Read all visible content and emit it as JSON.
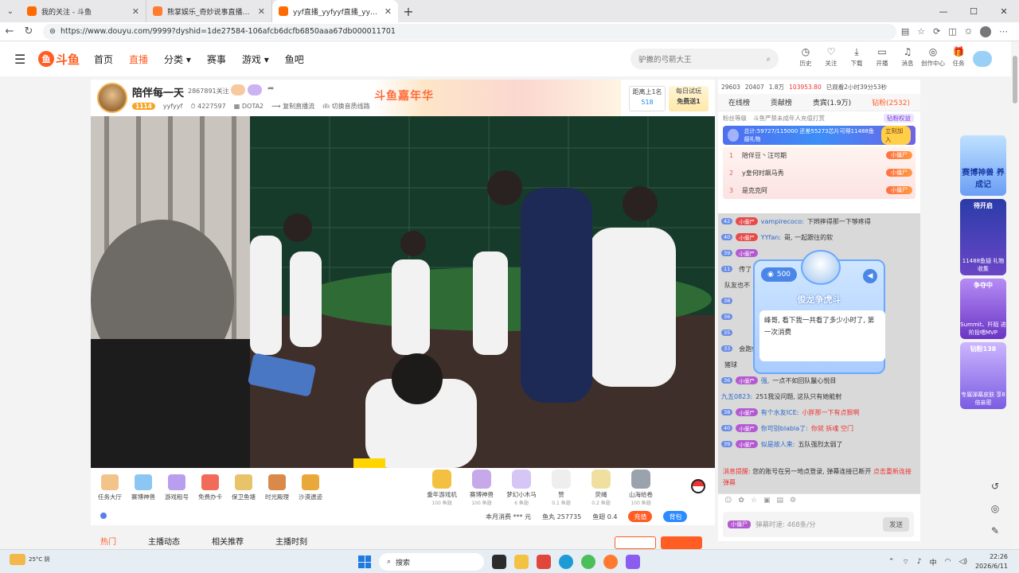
{
  "browser": {
    "tabs": [
      {
        "title": "我的关注 - 斗鱼",
        "active": false
      },
      {
        "title": "熊掌娱乐_奇妙说事直播_奇妙说事",
        "active": false
      },
      {
        "title": "yyf直播_yyfyyf直播_yyfDOTA2直播",
        "active": true
      }
    ],
    "url": "https://www.douyu.com/9999?dyshid=1de27584-106afcb6dcfb6850aaa67db000011701"
  },
  "header": {
    "logo_text": "斗鱼",
    "nav": [
      "首页",
      "直播",
      "分类",
      "赛事",
      "游戏",
      "鱼吧"
    ],
    "search_placeholder": "驴撒的弓箭大王",
    "icons": [
      "历史",
      "关注",
      "下载",
      "开播",
      "消息",
      "创作中心",
      "任务"
    ]
  },
  "room": {
    "name": "陪伴每一天",
    "followers": "2867891关注",
    "level": "1114",
    "id": "yyfyyf",
    "hot": "4227597",
    "category": "DOTA2",
    "copy_label": "复制直播流",
    "switch_label": "切换音质线路",
    "banner_text": "斗鱼嘉年华",
    "rank_label": "距离上1名",
    "rank_value": "518",
    "daily_label": "每日试玩",
    "daily_value": "免费送1"
  },
  "gift_bar": {
    "left_items": [
      "任务大厅",
      "赛博神兽",
      "游戏租号",
      "免费办卡",
      "保卫鱼塘",
      "时光殿理",
      "沙漠遗迹"
    ],
    "gifts": [
      {
        "name": "重年游戏机",
        "price": "100 鱼翅"
      },
      {
        "name": "赛博神兽",
        "price": "100 鱼翅"
      },
      {
        "name": "梦幻小木马",
        "price": "6 鱼翅"
      },
      {
        "name": "赞",
        "price": "0.1 鱼翅"
      },
      {
        "name": "荧绳",
        "price": "0.2 鱼翅"
      },
      {
        "name": "山海给卷",
        "price": "100 鱼翅"
      }
    ],
    "consume_label": "本月消费",
    "consume_value": "*** 元",
    "fishball": "鱼丸 257735",
    "fishfin": "鱼翅 0.4",
    "recharge": "充值",
    "bag": "背包"
  },
  "subtabs": [
    "热门",
    "主播动态",
    "相关推荐",
    "主播时刻"
  ],
  "chat": {
    "stats": [
      "29603",
      "20407",
      "1.8万",
      "103953.80",
      "已观看2小时39分53秒"
    ],
    "tabs": [
      "在线榜",
      "贡献榜",
      "贵宾(1.9万)",
      "钻粉(2532)"
    ],
    "notice_left": "粉丝等级",
    "notice_mid": "斗鱼严禁未成年人充值打赏",
    "notice_pill": "钻粉权益",
    "fan_bar": "总计:59727/115000 还差55273芯片可得11488鱼翅礼物",
    "fan_join": "立刻加入",
    "ranking": [
      {
        "no": "1",
        "name": "陪伴豆丶汪可期",
        "badge": "小僵尸"
      },
      {
        "no": "2",
        "name": "y皇何时飙马秀",
        "badge": "小僵尸"
      },
      {
        "no": "3",
        "name": "是克克阿",
        "badge": "小僵尸"
      }
    ],
    "messages": [
      {
        "user": "vampirecoco:",
        "text": "下辫摔得那一下够疼得"
      },
      {
        "user": "YYfan:",
        "text": "哥, 一起跟往的软"
      },
      {
        "user": "",
        "text": ""
      },
      {
        "user": "",
        "text": "传了"
      },
      {
        "user": "",
        "text": "队友也不"
      },
      {
        "user": "",
        "text": ""
      },
      {
        "user": "",
        "text": ""
      },
      {
        "user": "",
        "text": ""
      },
      {
        "user": "",
        "text": "会跑位"
      },
      {
        "user": "",
        "text": "猪球"
      },
      {
        "user": "强,",
        "text": "一点不如回队鬣心悦目"
      },
      {
        "user": "九五0823:",
        "text": "251我没问题, 这队只有她能射"
      },
      {
        "user": "有个水友ICE:",
        "text": "小胖那一下有点狠啊",
        "red": true
      },
      {
        "user": "你可别blabla了:",
        "text": "你就 拆魂 空门",
        "red": true
      },
      {
        "user": "似是故人来:",
        "text": "五队强烈太弱了"
      }
    ],
    "popup": {
      "coins": "500",
      "title": "俊龙争虎斗",
      "text": "峰哥, 看下我一共看了多少小时了, 第一次消费"
    },
    "system_label": "消息提醒:",
    "system_text": "您的账号在另一地点登录, 弹幕连接已断开",
    "system_link": "点击重新连接弹幕",
    "input_tag": "小僵尸",
    "input_placeholder": "弹幕时速: 468条/分",
    "send": "发送"
  },
  "promos": [
    {
      "top": "",
      "big": "赛博神兽 养成记",
      "label": ""
    },
    {
      "top": "待开启",
      "big": "",
      "label": "11488鱼翅 礼物收集"
    },
    {
      "top": "争夺中",
      "big": "",
      "label": "Summit、阡陌 进阶投喂MVP"
    },
    {
      "top": "钻粉138",
      "big": "",
      "label": "专属弹幕皮肤 享8倍亲密"
    }
  ],
  "taskbar": {
    "weather": "25°C 阴",
    "search": "搜索",
    "time": "22:26",
    "date": "2026/6/11",
    "ime": "中"
  }
}
